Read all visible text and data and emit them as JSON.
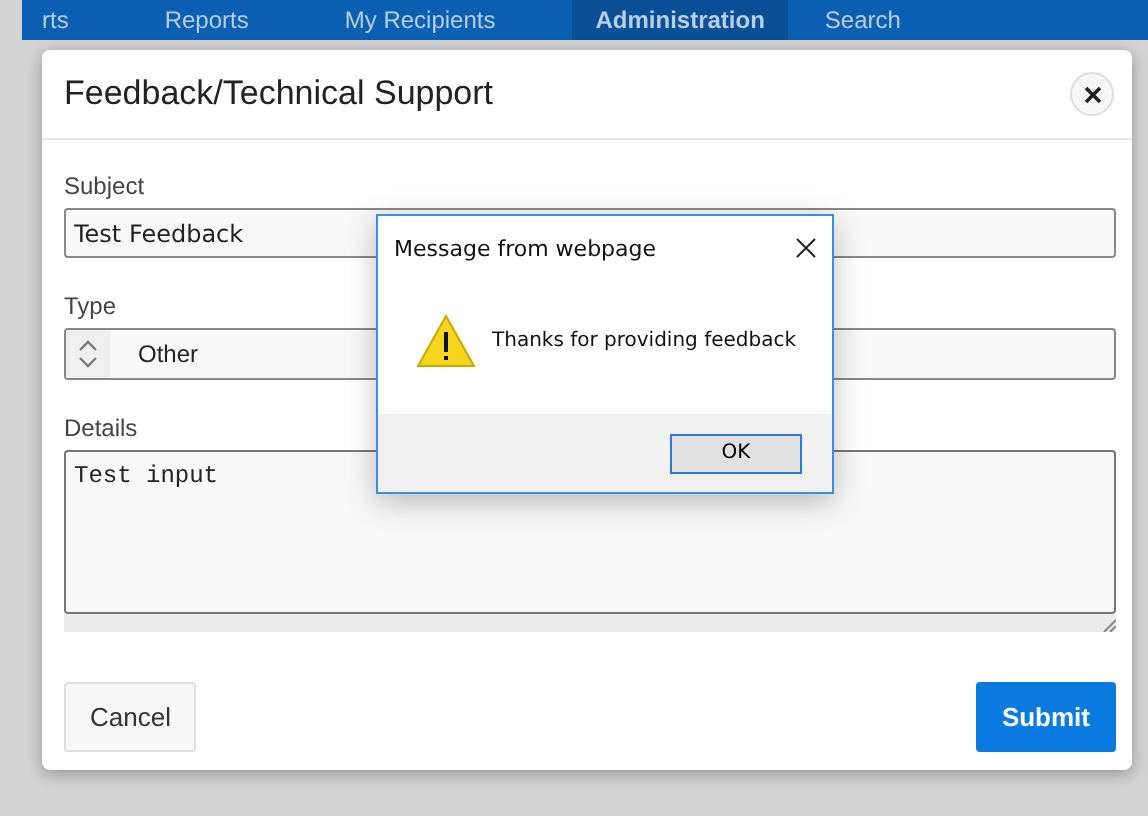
{
  "nav": {
    "items": [
      {
        "label": "rts",
        "selected": false
      },
      {
        "label": "Reports",
        "selected": false
      },
      {
        "label": "My Recipients",
        "selected": false
      },
      {
        "label": "Administration",
        "selected": true
      },
      {
        "label": "Search",
        "selected": false
      }
    ]
  },
  "modal": {
    "title": "Feedback/Technical Support",
    "fields": [
      {
        "kind": "text",
        "label": "Subject",
        "value": "Test Feedback"
      },
      {
        "kind": "select",
        "label": "Type",
        "value": "Other"
      },
      {
        "kind": "textarea",
        "label": "Details",
        "value": "Test input"
      }
    ],
    "buttons": [
      {
        "label": "Cancel",
        "kind": "secondary"
      },
      {
        "label": "Submit",
        "kind": "primary"
      }
    ]
  },
  "alert": {
    "title": "Message from webpage",
    "message": "Thanks for providing feedback",
    "button": "OK"
  }
}
